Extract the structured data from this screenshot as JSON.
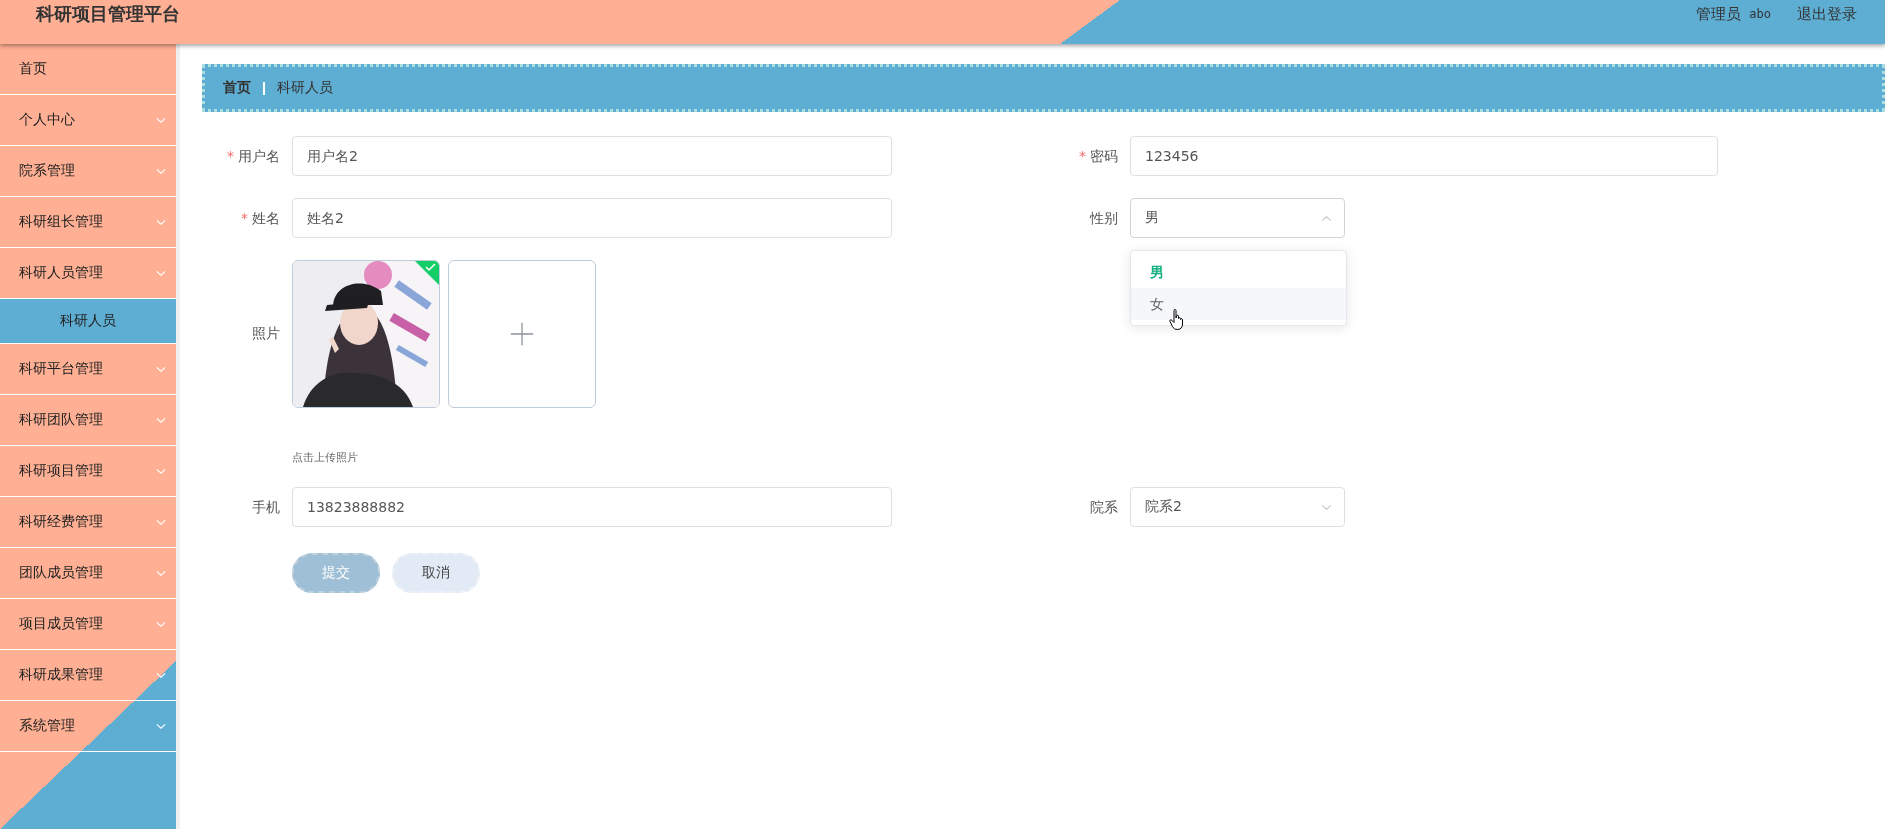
{
  "header": {
    "title": "科研项目管理平台",
    "role": "管理员",
    "username": "abo",
    "logout": "退出登录"
  },
  "sidebar": {
    "items": [
      {
        "kind": "link",
        "label": "首页"
      },
      {
        "kind": "menu",
        "label": "个人中心"
      },
      {
        "kind": "menu",
        "label": "院系管理"
      },
      {
        "kind": "menu",
        "label": "科研组长管理"
      },
      {
        "kind": "menu",
        "label": "科研人员管理",
        "children": [
          {
            "label": "科研人员",
            "selected": true
          }
        ]
      },
      {
        "kind": "menu",
        "label": "科研平台管理"
      },
      {
        "kind": "menu",
        "label": "科研团队管理"
      },
      {
        "kind": "menu",
        "label": "科研项目管理"
      },
      {
        "kind": "menu",
        "label": "科研经费管理"
      },
      {
        "kind": "menu",
        "label": "团队成员管理"
      },
      {
        "kind": "menu",
        "label": "项目成员管理"
      },
      {
        "kind": "menu",
        "label": "科研成果管理"
      },
      {
        "kind": "menu",
        "label": "系统管理"
      }
    ]
  },
  "breadcrumb": [
    "首页",
    "科研人员"
  ],
  "form": {
    "fields": [
      {
        "kind": "input",
        "required_mark": "*",
        "label": "用户名",
        "value": "用户名2"
      },
      {
        "kind": "input",
        "required_mark": "*",
        "label": "密码",
        "value": "123456"
      },
      {
        "kind": "input",
        "required_mark": "*",
        "label": "姓名",
        "value": "姓名2"
      },
      {
        "kind": "select",
        "label": "性别",
        "value": "男",
        "expanded": true,
        "options": [
          {
            "label": "男",
            "selected": true,
            "hovered": false
          },
          {
            "label": "女",
            "selected": false,
            "hovered": true
          }
        ]
      },
      {
        "kind": "upload",
        "label": "照片",
        "hint": "点击上传照片",
        "files": [
          {
            "kind": "picture",
            "uploaded": true
          }
        ]
      },
      {
        "kind": "input",
        "label": "手机",
        "value": "13823888882"
      },
      {
        "kind": "select",
        "label": "院系",
        "value": "院系2",
        "expanded": false
      }
    ],
    "buttons": [
      {
        "kind": "primary",
        "label": "提交"
      },
      {
        "kind": "secondary",
        "label": "取消"
      }
    ]
  }
}
